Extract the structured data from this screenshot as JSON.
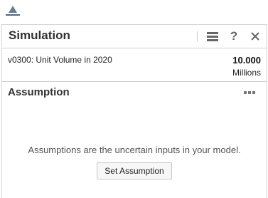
{
  "top_tab": {
    "icon": "chart-triangle-icon"
  },
  "panel": {
    "title": "Simulation",
    "icons": [
      "menu-icon",
      "help-icon",
      "close-icon"
    ],
    "help_label": "?"
  },
  "forecast": {
    "label": "v0300: Unit Volume in 2020",
    "value": "10.000",
    "unit": "Millions"
  },
  "assumption": {
    "title": "Assumption",
    "more_icon": "more-icon",
    "hint": "Assumptions are the uncertain inputs in your model.",
    "button_label": "Set Assumption"
  },
  "colors": {
    "accent": "#4a6a8a",
    "divider": "#cfcfcf",
    "icon": "#666666"
  }
}
